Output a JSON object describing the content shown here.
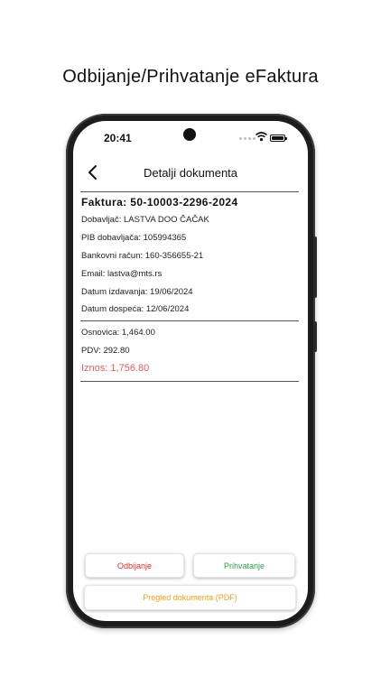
{
  "promo": {
    "title": "Odbijanje/Prihvatanje eFaktura"
  },
  "status_bar": {
    "time": "20:41",
    "icons": [
      "signal-icon",
      "wifi-icon",
      "battery-icon"
    ]
  },
  "nav": {
    "back_icon": "chevron-left-icon",
    "title": "Detalji dokumenta"
  },
  "invoice": {
    "title": "Faktura: 50-10003-2296-2024",
    "details": [
      "Dobavljač: LASTVA DOO ČAČAK",
      "PIB dobavljača: 105994365",
      "Bankovni račun: 160-356655-21",
      "Email: lastva@mts.rs",
      "Datum izdavanja: 19/06/2024",
      "Datum dospeća: 12/06/2024"
    ],
    "amounts": {
      "base": "Osnovica: 1,464.00",
      "vat": "PDV: 292.80",
      "total": "Iznos: 1,756.80"
    }
  },
  "actions": {
    "reject": "Odbijanje",
    "accept": "Prihvatanje",
    "pdf": "Pregled dokumenta (PDF)"
  },
  "colors": {
    "reject": "#d32f2f",
    "accept": "#2e9e4f",
    "pdf": "#f0a020",
    "total": "#e35d5d"
  }
}
